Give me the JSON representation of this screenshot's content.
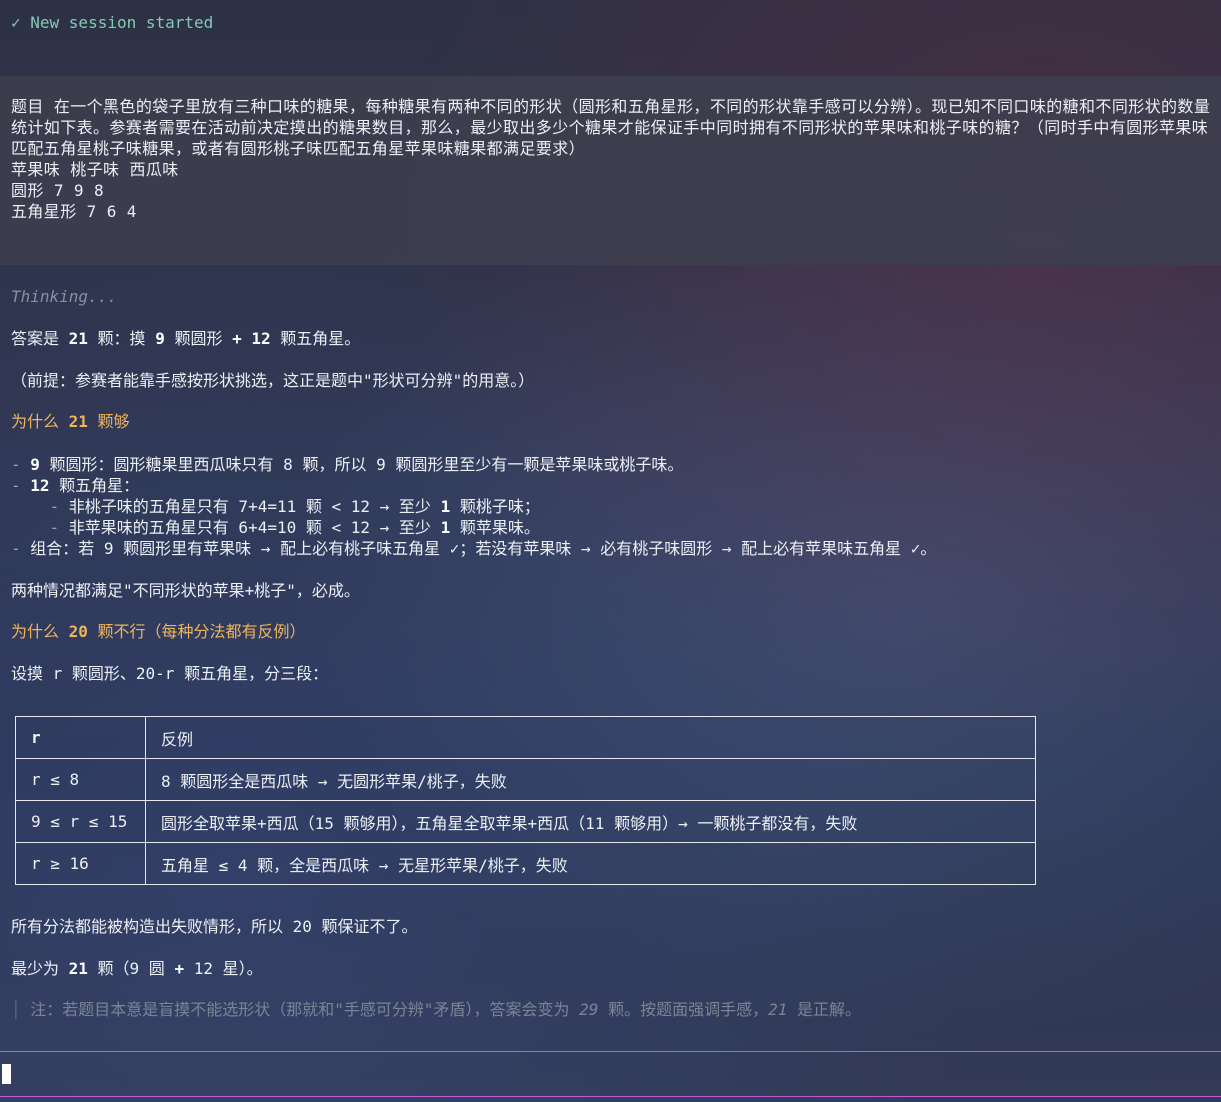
{
  "session": {
    "status": "✓ New session started"
  },
  "question": {
    "text": "题目 在一个黑色的袋子里放有三种口味的糖果，每种糖果有两种不同的形状（圆形和五角星形，不同的形状靠手感可以分辨）。现已知不同口味的糖和不同形状的数量统计如下表。参赛者需要在活动前决定摸出的糖果数目，那么，最少取出多少个糖果才能保证手中同时拥有不同形状的苹果味和桃子味的糖？（同时手中有圆形苹果味匹配五角星桃子味糖果，或者有圆形桃子味匹配五角星苹果味糖果都满足要求）",
    "table_header": "苹果味 桃子味 西瓜味",
    "row_round": "圆形 7 9 8",
    "row_star": "五角星形 7 6 4"
  },
  "thinking": "Thinking...",
  "answer": {
    "line1_pre": "答案是 ",
    "line1_b1": "21",
    "line1_mid1": " 颗：摸 ",
    "line1_b2": "9",
    "line1_mid2": " 颗圆形 ",
    "line1_b3": "+ 12",
    "line1_post": " 颗五角星。",
    "premise": "（前提：参赛者能靠手感按形状挑选，这正是题中\"形状可分辨\"的用意。）",
    "h1_pre": "为什么 ",
    "h1_b": "21",
    "h1_post": " 颗够",
    "b1_dash": "- ",
    "b1_bold": "9",
    "b1_text": " 颗圆形：圆形糖果里西瓜味只有 8 颗，所以 9 颗圆形里至少有一颗是苹果味或桃子味。",
    "b2_dash": "- ",
    "b2_bold": "12",
    "b2_text": " 颗五角星：",
    "b2a_dash": "    - ",
    "b2a_text": "非桃子味的五角星只有 7+4=11 颗 < 12 → 至少 ",
    "b2a_bold": "1",
    "b2a_post": " 颗桃子味；",
    "b2b_dash": "    - ",
    "b2b_text": "非苹果味的五角星只有 6+4=10 颗 < 12 → 至少 ",
    "b2b_bold": "1",
    "b2b_post": " 颗苹果味。",
    "b3_dash": "- ",
    "b3_text": "组合：若 9 颗圆形里有苹果味 → 配上必有桃子味五角星 ✓；若没有苹果味 → 必有桃子味圆形 → 配上必有苹果味五角星 ✓。",
    "both": "两种情况都满足\"不同形状的苹果+桃子\"，必成。",
    "h2_pre": "为什么 ",
    "h2_b": "20",
    "h2_post": " 颗不行（每种分法都有反例）",
    "setup": "设摸 r 颗圆形、20-r 颗五角星，分三段：",
    "conclusion1": "所有分法都能被构造出失败情形，所以 20 颗保证不了。",
    "final_pre": "最少为 ",
    "final_b1": "21",
    "final_mid": " 颗（9 圆 ",
    "final_b2": "+",
    "final_post": " 12 星）。",
    "note_bar": "│ ",
    "note_pre": "注：若题目本意是盲摸不能选形状（那就和\"手感可分辨\"矛盾），答案会变为 ",
    "note_em1": "29",
    "note_mid": " 颗。按题面强调手感，",
    "note_em2": "21",
    "note_post": " 是正解。"
  },
  "counter_table": {
    "headers": [
      "r",
      "反例"
    ],
    "rows": [
      [
        "r ≤ 8",
        "8 颗圆形全是西瓜味 → 无圆形苹果/桃子，失败"
      ],
      [
        "9 ≤ r ≤ 15",
        "圆形全取苹果+西瓜（15 颗够用），五角星全取苹果+西瓜（11 颗够用）→ 一颗桃子都没有，失败"
      ],
      [
        "r ≥ 16",
        "五角星 ≤ 4 颗，全是西瓜味 → 无星形苹果/桃子，失败"
      ]
    ]
  },
  "colors": {
    "session_text": "#86c8b6",
    "heading": "#f0b45a",
    "input_border": "#c35ad6",
    "muted": "#7d8396"
  }
}
